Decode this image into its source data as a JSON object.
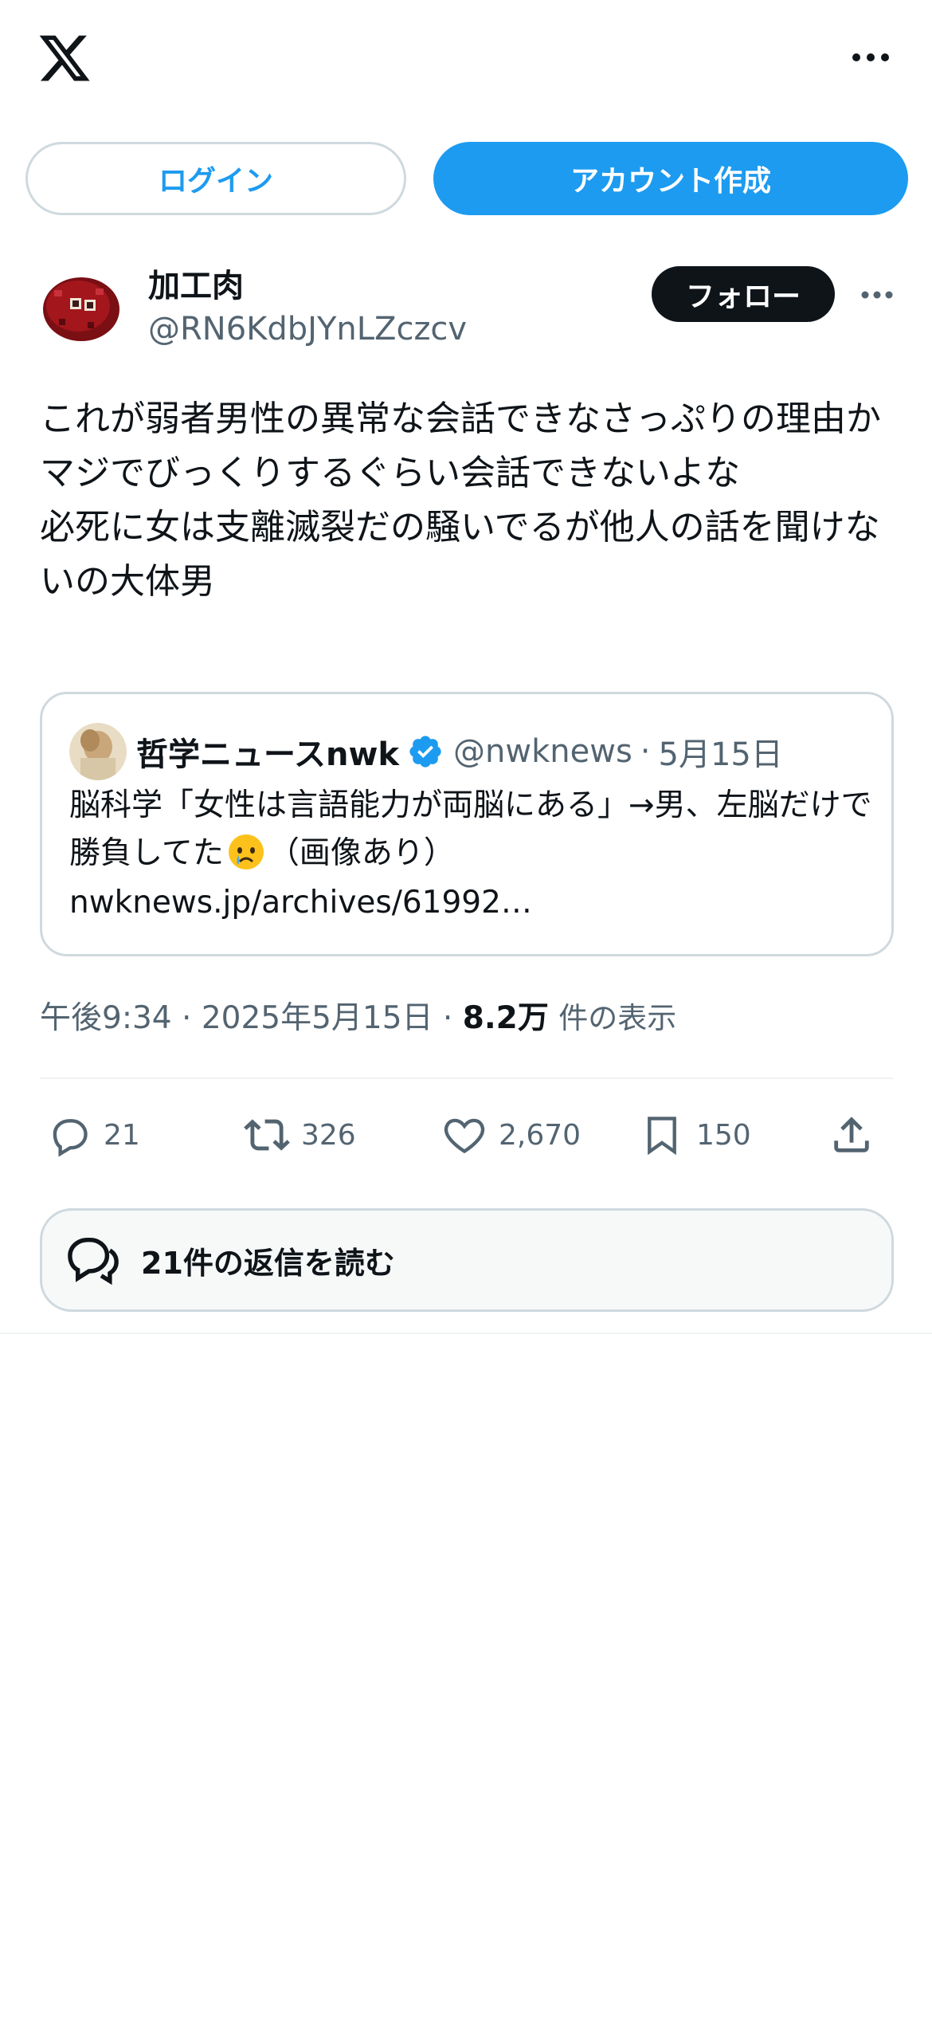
{
  "header": {
    "logo": "x-logo",
    "more_icon": "more-horizontal-icon"
  },
  "auth": {
    "login_label": "ログイン",
    "signup_label": "アカウント作成"
  },
  "tweet": {
    "author_name": "加工肉",
    "author_handle": "@RN6KdbJYnLZczcv",
    "follow_label": "フォロー",
    "text": "これが弱者男性の異常な会話できなさっぷりの理由か\nマジでびっくりするぐらい会話できないよな\n必死に女は支離滅裂だの騒いでるが他人の話を聞けないの大体男",
    "quote": {
      "name": "哲学ニュースnwk",
      "handle": "@nwknews",
      "separator": "·",
      "date": "5月15日",
      "text_before": "脳科学「女性は言語能力が両脳にある」→男、左脳だけで勝負してた",
      "text_after": "（画像あり）",
      "link": "nwknews.jp/archives/61992…",
      "emoji": "crying-face-emoji"
    },
    "time": "午後9:34",
    "dot": "·",
    "date": "2025年5月15日",
    "views_count": "8.2万",
    "views_label": "件の表示",
    "stats": {
      "replies": "21",
      "retweets": "326",
      "likes": "2,670",
      "bookmarks": "150"
    },
    "read_replies_label": "21件の返信を読む"
  },
  "colors": {
    "accent": "#1d9bf0",
    "text": "#0f1419",
    "muted": "#536471",
    "border": "#cfd9de"
  }
}
